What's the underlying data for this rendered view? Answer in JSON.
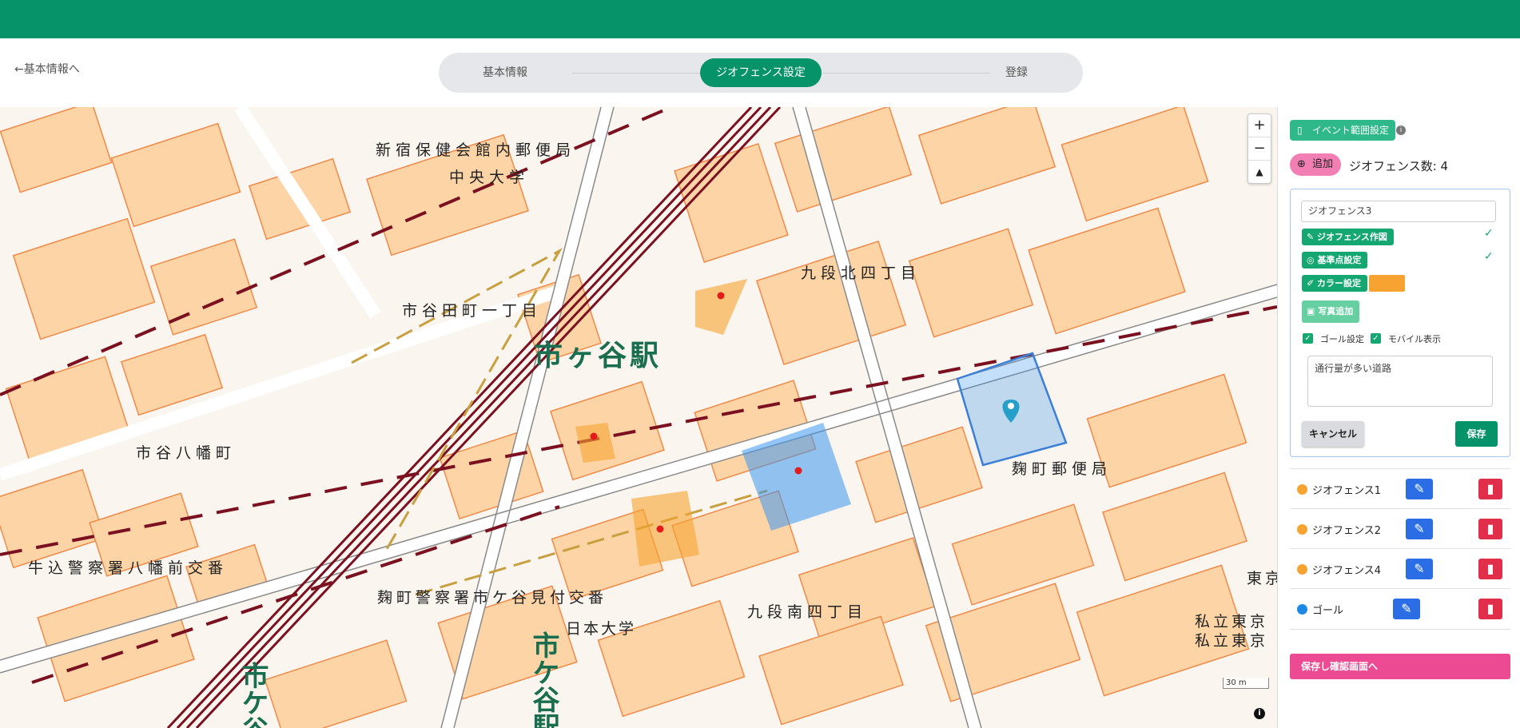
{
  "header": {
    "back_link": "←基本情報へ"
  },
  "stepper": {
    "steps": [
      "基本情報",
      "ジオフェンス設定",
      "登録"
    ],
    "active_index": 1
  },
  "map": {
    "labels": {
      "shinjuku_post": "新宿保健会館内郵便局",
      "chuo_univ": "中央大学",
      "kudan_kita": "九段北四丁目",
      "ichigaya_tamachi": "市谷田町一丁目",
      "ichigaya_station": "市ヶ谷駅",
      "ichigaya_hachiman": "市谷八幡町",
      "kojimachi_post": "麹町郵便局",
      "ushigome_police": "牛込警察署八幡前交番",
      "kojimachi_police": "麹町警察署市ケ谷見付交番",
      "nihon_univ": "日本大学",
      "kudan_minami": "九段南四丁目",
      "shiritsu1": "私立東京",
      "shiritsu2": "私立東京",
      "tokyo": "東京",
      "vertical_station_1": "市ケ谷駅",
      "vertical_station_2": "市ケ谷"
    },
    "zoom_in": "+",
    "zoom_out": "−",
    "compass": "▲",
    "scale": "30 m",
    "info": "i"
  },
  "panel": {
    "event_range_button": "イベント範囲設定",
    "add_button": "追加",
    "geofence_count_label": "ジオフェンス数: 4",
    "editor": {
      "name_value": "ジオフェンス3",
      "draw_button": "ジオフェンス作図",
      "base_point_button": "基準点設定",
      "color_button": "カラー設定",
      "color_value": "#f7a331",
      "photo_button": "写真追加",
      "goal_setting": "ゴール設定",
      "mobile_display": "モバイル表示",
      "memo": "通行量が多い道路",
      "cancel": "キャンセル",
      "save": "保存"
    },
    "list": [
      {
        "name": "ジオフェンス1",
        "color": "#f7a331"
      },
      {
        "name": "ジオフェンス2",
        "color": "#f7a331"
      },
      {
        "name": "ジオフェンス4",
        "color": "#f7a331"
      },
      {
        "name": "ゴール",
        "color": "#1e88e5"
      }
    ],
    "final_button": "保存し確認画面へ"
  }
}
